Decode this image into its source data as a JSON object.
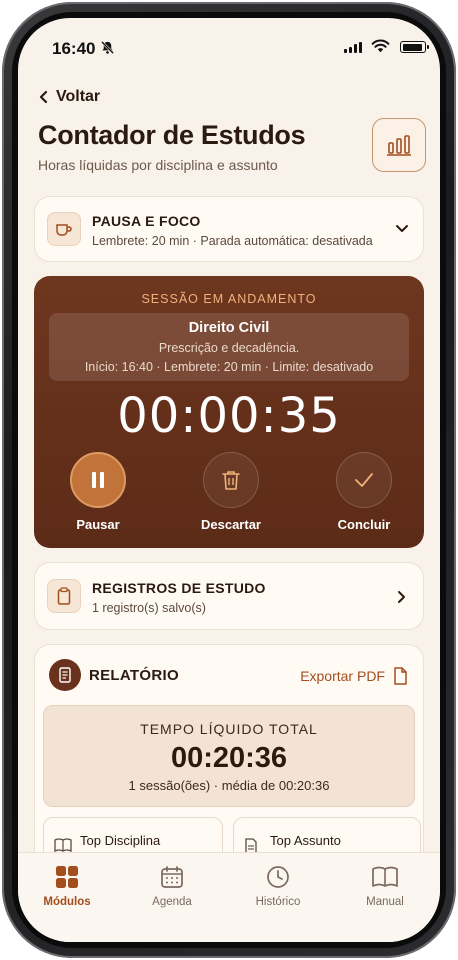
{
  "status_bar": {
    "time": "16:40"
  },
  "header": {
    "back_label": "Voltar",
    "title": "Contador de Estudos",
    "subtitle": "Horas líquidas por disciplina e assunto"
  },
  "pause_focus": {
    "title": "PAUSA E FOCO",
    "detail": "Lembrete: 20 min · Parada automática: desativada"
  },
  "session": {
    "label": "SESSÃO EM ANDAMENTO",
    "discipline": "Direito Civil",
    "topic": "Prescrição e decadência.",
    "meta": "Início: 16:40 · Lembrete: 20 min · Limite: desativado",
    "timer": "00:00:35",
    "pause_label": "Pausar",
    "discard_label": "Descartar",
    "finish_label": "Concluir"
  },
  "records": {
    "title": "REGISTROS DE ESTUDO",
    "detail": "1 registro(s) salvo(s)"
  },
  "report": {
    "title": "RELATÓRIO",
    "export_label": "Exportar PDF",
    "total_label": "TEMPO LÍQUIDO TOTAL",
    "total_value": "00:20:36",
    "total_sub": "1 sessão(ões) · média de 00:20:36",
    "top_discipline_label": "Top Disciplina",
    "top_topic_label": "Top Assunto"
  },
  "tabbar": {
    "items": [
      {
        "label": "Módulos",
        "icon": "grid-icon",
        "active": true
      },
      {
        "label": "Agenda",
        "icon": "calendar-icon",
        "active": false
      },
      {
        "label": "Histórico",
        "icon": "clock-icon",
        "active": false
      },
      {
        "label": "Manual",
        "icon": "book-icon",
        "active": false
      }
    ]
  },
  "colors": {
    "accent": "#a24e1e",
    "session_bg": "#6a321c",
    "background": "#f8f2ea"
  }
}
